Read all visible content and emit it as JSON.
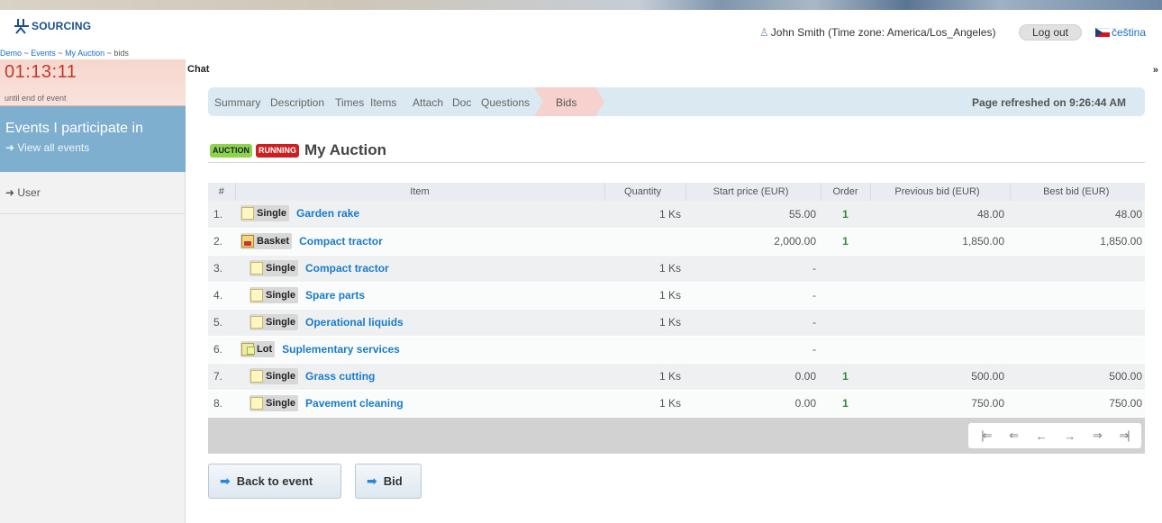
{
  "header": {
    "logo_text": "SOURCING",
    "user": "John Smith (Time zone: America/Los_Angeles)",
    "logout_label": "Log out",
    "language": "čeština"
  },
  "breadcrumb": [
    "Demo",
    "Events",
    "My Auction",
    "bids"
  ],
  "sidebar": {
    "countdown": "01:13:11",
    "countdown_label": "until end of event",
    "events_title": "Events I participate in",
    "view_all_label": "View all events",
    "user_label": "User"
  },
  "chat": {
    "label": "Chat",
    "toggle": "»"
  },
  "tabs": [
    "Summary",
    "Description",
    "Times",
    "Items",
    "Attach",
    "Doc",
    "Questions"
  ],
  "active_tab": "Bids",
  "refreshed": "Page refreshed on 9:26:44 AM",
  "event": {
    "badge_type": "AUCTION",
    "badge_status": "RUNNING",
    "title": "My Auction"
  },
  "table": {
    "headers": [
      "#",
      "Item",
      "Quantity",
      "Start price (EUR)",
      "Order",
      "Previous bid (EUR)",
      "Best bid (EUR)"
    ],
    "rows": [
      {
        "num": "1.",
        "type": "Single",
        "name": "Garden rake",
        "qty": "1 Ks",
        "start": "55.00",
        "order": "1",
        "prev": "48.00",
        "best": "48.00"
      },
      {
        "num": "2.",
        "type": "Basket",
        "name": "Compact tractor",
        "qty": "",
        "start": "2,000.00",
        "order": "1",
        "prev": "1,850.00",
        "best": "1,850.00"
      },
      {
        "num": "3.",
        "type": "Single",
        "name": "Compact tractor",
        "qty": "1 Ks",
        "start": "-",
        "order": "",
        "prev": "",
        "best": ""
      },
      {
        "num": "4.",
        "type": "Single",
        "name": "Spare parts",
        "qty": "1 Ks",
        "start": "-",
        "order": "",
        "prev": "",
        "best": ""
      },
      {
        "num": "5.",
        "type": "Single",
        "name": "Operational liquids",
        "qty": "1 Ks",
        "start": "-",
        "order": "",
        "prev": "",
        "best": ""
      },
      {
        "num": "6.",
        "type": "Lot",
        "name": "Suplementary services",
        "qty": "",
        "start": "-",
        "order": "",
        "prev": "",
        "best": ""
      },
      {
        "num": "7.",
        "type": "Single",
        "name": "Grass cutting",
        "qty": "1 Ks",
        "start": "0.00",
        "order": "1",
        "prev": "500.00",
        "best": "500.00"
      },
      {
        "num": "8.",
        "type": "Single",
        "name": "Pavement cleaning",
        "qty": "1 Ks",
        "start": "0.00",
        "order": "1",
        "prev": "750.00",
        "best": "750.00"
      }
    ]
  },
  "pager": {
    "first": "|⇐",
    "prev_page": "⇐",
    "prev": "←",
    "next": "→",
    "next_page": "⇒",
    "last": "⇒|"
  },
  "buttons": {
    "back_label": "Back to event",
    "bid_label": "Bid"
  }
}
